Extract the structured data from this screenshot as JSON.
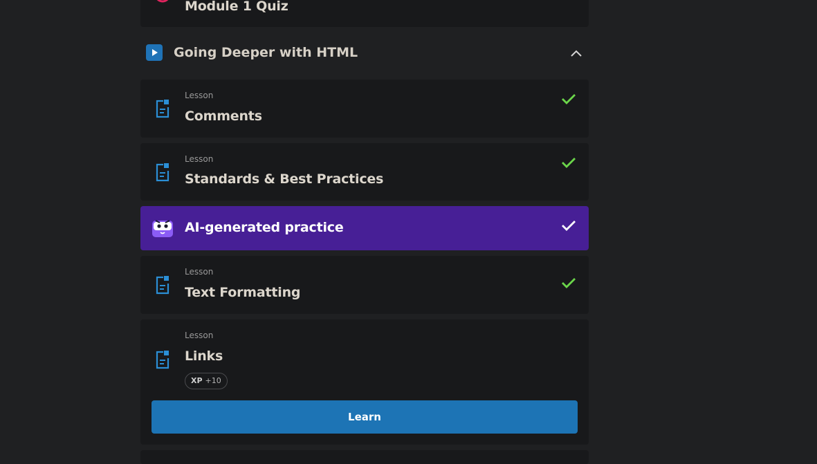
{
  "previous_item": {
    "title": "Module 1 Quiz"
  },
  "section": {
    "title": "Going Deeper with HTML",
    "expanded": true
  },
  "items": [
    {
      "kicker": "Lesson",
      "title": "Comments",
      "completed": true,
      "icon": "lesson-document-icon"
    },
    {
      "kicker": "Lesson",
      "title": "Standards & Best Practices",
      "completed": true,
      "icon": "lesson-document-icon"
    },
    {
      "title": "AI-generated practice",
      "completed": true,
      "icon": "ai-mascot-icon"
    },
    {
      "kicker": "Lesson",
      "title": "Text Formatting",
      "completed": true,
      "icon": "lesson-document-icon"
    },
    {
      "kicker": "Lesson",
      "title": "Links",
      "completed": false,
      "icon": "lesson-document-icon",
      "xp_label": "XP",
      "xp_value": "+10",
      "action_label": "Learn"
    }
  ],
  "colors": {
    "background": "#1f2022",
    "card": "#18191b",
    "ai_card": "#471f96",
    "accent_blue": "#1d74b5",
    "check_green": "#6bd64a",
    "lesson_icon_blue": "#2b8fd6"
  }
}
